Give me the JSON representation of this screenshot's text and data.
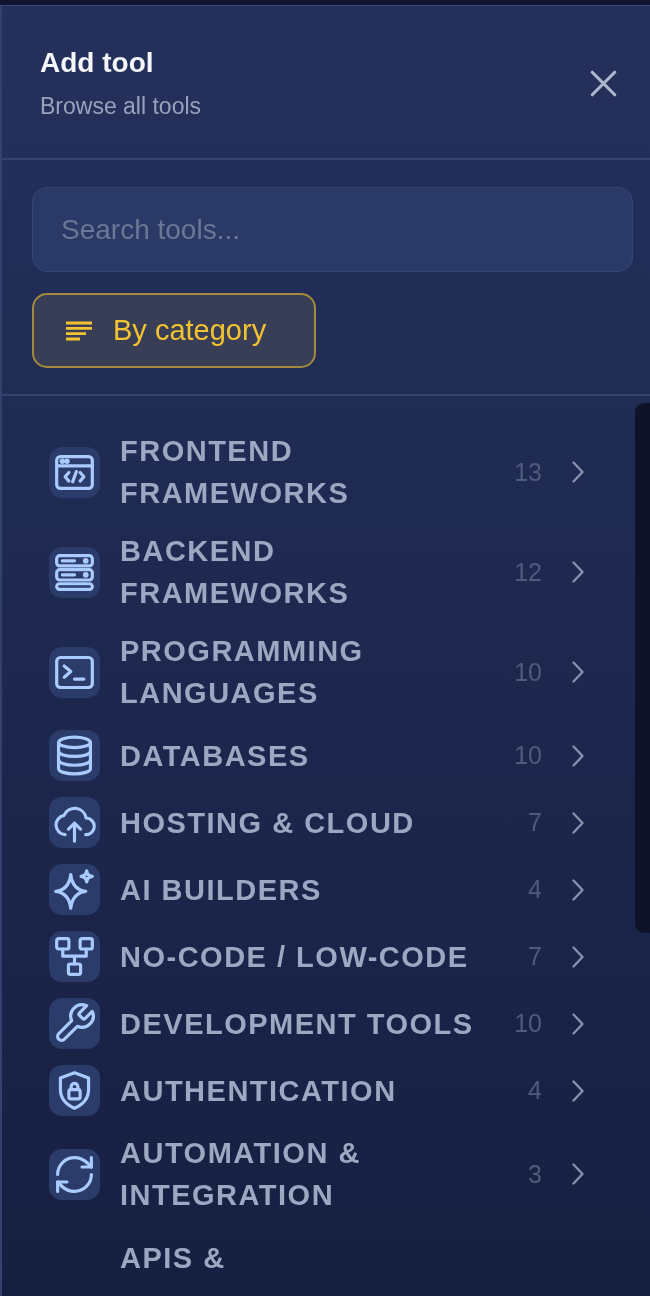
{
  "panel": {
    "title": "Add tool",
    "subtitle": "Browse all tools"
  },
  "search": {
    "placeholder": "Search tools..."
  },
  "filter_button": {
    "label": "By category",
    "selected": true
  },
  "categories": [
    {
      "kind": "code-window",
      "title": "FRONTEND FRAMEWORKS",
      "count": "13"
    },
    {
      "kind": "server",
      "title": "BACKEND FRAMEWORKS",
      "count": "12"
    },
    {
      "kind": "terminal",
      "title": "PROGRAMMING LANGUAGES",
      "count": "10"
    },
    {
      "kind": "database",
      "title": "DATABASES",
      "count": "10"
    },
    {
      "kind": "cloud",
      "title": "HOSTING & CLOUD",
      "count": "7"
    },
    {
      "kind": "sparkle",
      "title": "AI BUILDERS",
      "count": "4"
    },
    {
      "kind": "flow",
      "title": "NO-CODE / LOW-CODE",
      "count": "7"
    },
    {
      "kind": "wrench",
      "title": "DEVELOPMENT TOOLS",
      "count": "10"
    },
    {
      "kind": "shield",
      "title": "AUTHENTICATION",
      "count": "4"
    },
    {
      "kind": "sync",
      "title": "AUTOMATION & INTEGRATION",
      "count": "3"
    },
    {
      "title": "APIS &"
    }
  ]
}
